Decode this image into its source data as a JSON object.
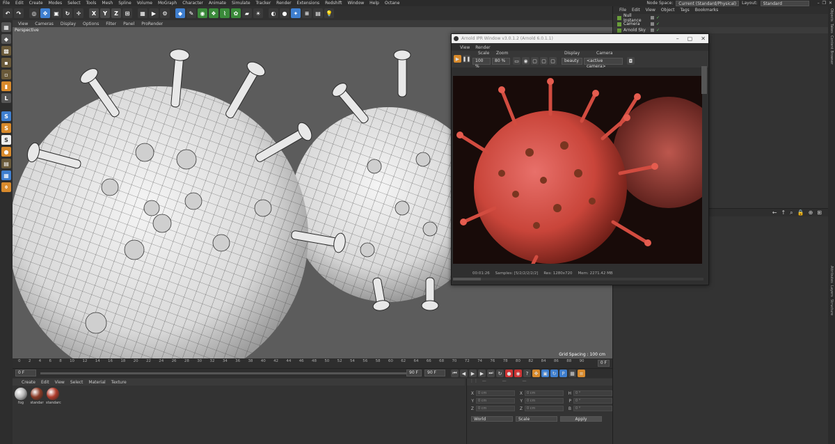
{
  "menubar": {
    "items": [
      "File",
      "Edit",
      "Create",
      "Modes",
      "Select",
      "Tools",
      "Mesh",
      "Spline",
      "Volume",
      "MoGraph",
      "Character",
      "Animate",
      "Simulate",
      "Tracker",
      "Render",
      "Extensions",
      "Redshift",
      "Window",
      "Help",
      "Octane"
    ],
    "node_space_label": "Node Space:",
    "node_space_value": "Current (Standard/Physical)",
    "layout_label": "Layout:",
    "layout_value": "Standard"
  },
  "viewport": {
    "menu": [
      "View",
      "Cameras",
      "Display",
      "Options",
      "Filter",
      "Panel",
      "ProRender"
    ],
    "label": "Perspective",
    "grid_spacing": "Grid Spacing : 100 cm"
  },
  "timeline": {
    "ticks": [
      "0",
      "2",
      "4",
      "6",
      "8",
      "10",
      "12",
      "14",
      "16",
      "18",
      "20",
      "22",
      "24",
      "26",
      "28",
      "30",
      "32",
      "34",
      "36",
      "38",
      "40",
      "42",
      "44",
      "46",
      "48",
      "50",
      "52",
      "54",
      "56",
      "58",
      "60",
      "62",
      "64",
      "66",
      "68",
      "70",
      "72",
      "74",
      "76",
      "78",
      "80",
      "82",
      "84",
      "86",
      "88",
      "90"
    ],
    "current_frame": "0 F"
  },
  "transport": {
    "start": "0 F",
    "min": "0 F",
    "end": "90 F",
    "max": "90 F"
  },
  "material_manager": {
    "menu": [
      "Create",
      "Edit",
      "View",
      "Select",
      "Material",
      "Texture"
    ],
    "materials": [
      {
        "name": "fog",
        "color": "#b8b8b8"
      },
      {
        "name": "standar",
        "color": "#8a3a26"
      },
      {
        "name": "standarc",
        "color": "#b03a2a"
      }
    ]
  },
  "coordinates": {
    "rows": [
      {
        "a": "X",
        "av": "0 cm",
        "b": "X",
        "bv": "0 cm",
        "c": "H",
        "cv": "0 °"
      },
      {
        "a": "Y",
        "av": "0 cm",
        "b": "Y",
        "bv": "0 cm",
        "c": "P",
        "cv": "0 °"
      },
      {
        "a": "Z",
        "av": "0 cm",
        "b": "Z",
        "bv": "0 cm",
        "c": "B",
        "cv": "0 °"
      }
    ],
    "world": "World",
    "scale": "Scale",
    "apply": "Apply"
  },
  "object_manager": {
    "menu": [
      "File",
      "Edit",
      "View",
      "Object",
      "Tags",
      "Bookmarks"
    ],
    "objects": [
      "Null Instance",
      "Camera",
      "Arnold Sky"
    ]
  },
  "side_tabs": [
    "Objects",
    "Takes",
    "Content Browser",
    "Attributes",
    "Layers",
    "Structure"
  ],
  "arnold": {
    "title": "Arnold IPR Window v3.0.1.2 (Arnold 6.0.1.1)",
    "menu": [
      "View",
      "Render"
    ],
    "scale_label": "Scale",
    "scale_value": "100 %",
    "zoom_label": "Zoom",
    "zoom_value": "80 %",
    "display_label": "Display",
    "display_value": "beauty",
    "camera_label": "Camera",
    "camera_value": "<active camera>",
    "status_time": "00:01:26",
    "status_samples": "Samples: [5/2/2/2/2/2]",
    "status_res": "Res: 1280x720",
    "status_mem": "Mem: 2271.42 MB"
  },
  "colors": {
    "accent_blue": "#3f7fcf",
    "orange": "#e08a1c",
    "virus_red": "#c9453a"
  }
}
